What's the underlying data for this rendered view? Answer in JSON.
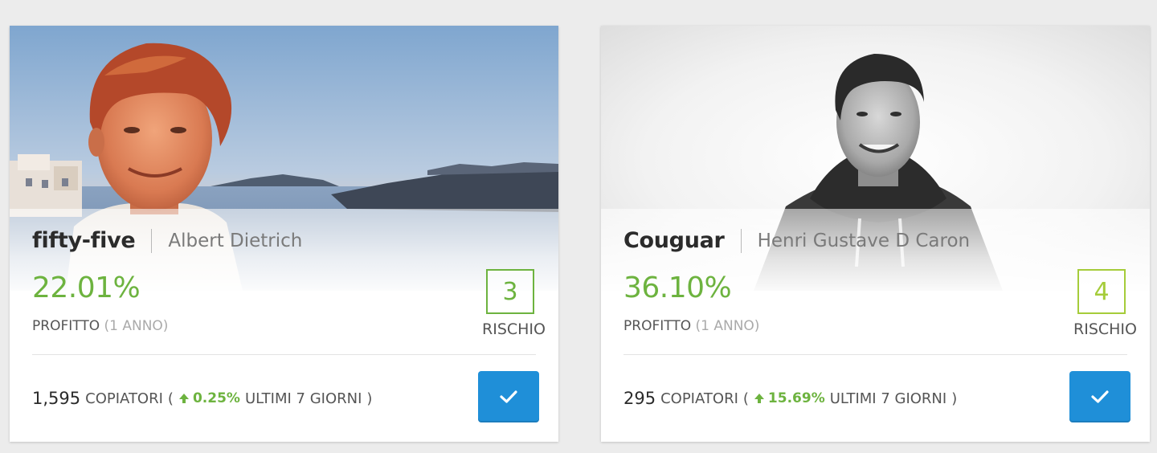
{
  "cards": [
    {
      "username": "fifty-five",
      "full_name": "Albert Dietrich",
      "profit": "22.01%",
      "profit_label": "PROFITTO",
      "profit_period": "(1 ANNO)",
      "risk_value": "3",
      "risk_label": "RISCHIO",
      "copiers_count": "1,595",
      "copiers_label": "COPIATORI",
      "paren_open": "(",
      "change_pct": "0.25%",
      "period_label": "ULTIMI 7 GIORNI",
      "paren_close": ")",
      "risk_color": "#6db33f",
      "photo_style": "color",
      "icons": {
        "trend": "arrow-up-icon",
        "action": "checkmark-icon"
      }
    },
    {
      "username": "Couguar",
      "full_name": "Henri Gustave D Caron",
      "profit": "36.10%",
      "profit_label": "PROFITTO",
      "profit_period": "(1 ANNO)",
      "risk_value": "4",
      "risk_label": "RISCHIO",
      "copiers_count": "295",
      "copiers_label": "COPIATORI",
      "paren_open": "(",
      "change_pct": "15.69%",
      "period_label": "ULTIMI 7 GIORNI",
      "paren_close": ")",
      "risk_color": "#a5cc3a",
      "photo_style": "grayscale",
      "icons": {
        "trend": "arrow-up-icon",
        "action": "checkmark-icon"
      }
    }
  ],
  "colors": {
    "profit_green": "#6db33f",
    "button_blue": "#1f8fd8",
    "background": "#ececec"
  }
}
